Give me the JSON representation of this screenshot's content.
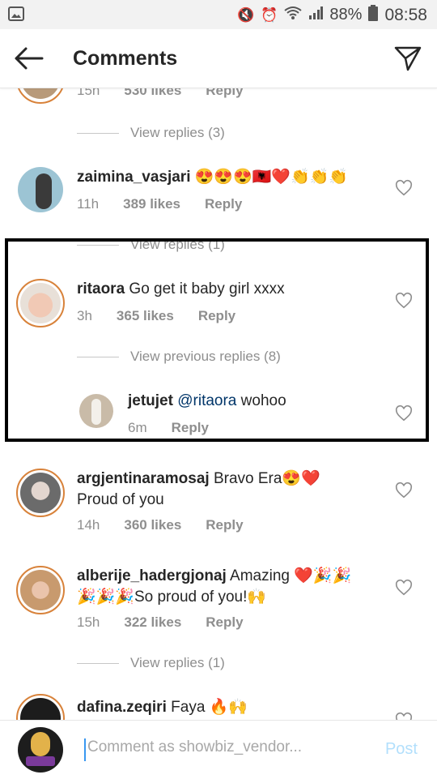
{
  "status_bar": {
    "battery": "88%",
    "time": "08:58"
  },
  "header": {
    "title": "Comments"
  },
  "comments": [
    {
      "time": "15h",
      "likes": "530 likes",
      "reply": "Reply",
      "view_replies": "View replies (3)"
    },
    {
      "user": "zaimina_vasjari",
      "text": "😍😍😍🇦🇱❤️👏👏👏",
      "time": "11h",
      "likes": "389 likes",
      "reply": "Reply",
      "view_replies": "View replies (1)"
    },
    {
      "user": "ritaora",
      "text": "Go get it baby girl xxxx",
      "time": "3h",
      "likes": "365 likes",
      "reply": "Reply",
      "view_previous": "View previous replies (8)"
    },
    {
      "user": "jetujet",
      "mention": "@ritaora",
      "text": "wohoo",
      "time": "6m",
      "reply": "Reply"
    },
    {
      "user": "argjentinaramosaj",
      "text": "Bravo Era😍❤️",
      "text2": "Proud of you",
      "time": "14h",
      "likes": "360 likes",
      "reply": "Reply"
    },
    {
      "user": "alberije_hadergjonaj",
      "text": "Amazing ❤️🎉🎉",
      "text2": "🎉🎉🎉So proud of you!🙌",
      "time": "15h",
      "likes": "322 likes",
      "reply": "Reply",
      "view_replies": "View replies (1)"
    },
    {
      "user": "dafina.zeqiri",
      "text": "Faya 🔥🙌"
    }
  ],
  "composer": {
    "placeholder": "Comment as showbiz_vendor...",
    "post_label": "Post"
  }
}
